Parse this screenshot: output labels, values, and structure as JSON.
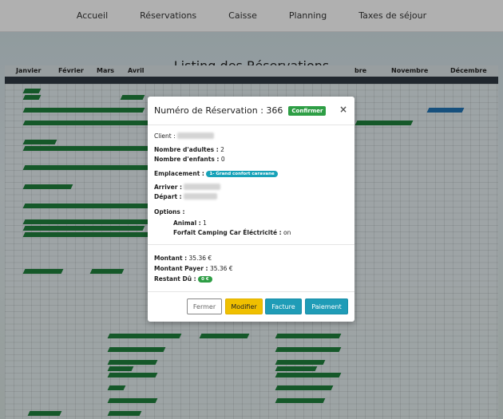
{
  "nav": {
    "items": [
      {
        "label": "Accueil"
      },
      {
        "label": "Réservations"
      },
      {
        "label": "Caisse"
      },
      {
        "label": "Planning"
      },
      {
        "label": "Taxes de séjour"
      }
    ]
  },
  "page": {
    "title": "Listing des Réservations"
  },
  "calendar": {
    "months": [
      "Janvier",
      "Février",
      "Mars",
      "Avril",
      "bre",
      "Novembre",
      "Décembre"
    ]
  },
  "modal": {
    "title": "Numéro de Réservation : 366",
    "status_badge": "Confirmer",
    "close_glyph": "×",
    "client_label": "Client :",
    "adults_label": "Nombre d'adultes :",
    "adults_value": "2",
    "children_label": "Nombre d'enfants :",
    "children_value": "0",
    "location_label": "Emplacement :",
    "location_value": "1- Grand confort caravane",
    "arrival_label": "Arriver :",
    "departure_label": "Départ :",
    "options_label": "Options :",
    "option1_label": "Animal :",
    "option1_value": "1",
    "option2_label": "Forfait Camping Car Éléctricité :",
    "option2_value": "on",
    "amount_label": "Montant :",
    "amount_value": "35.36 €",
    "paid_label": "Montant Payer :",
    "paid_value": "35.36 €",
    "due_label": "Restant Dû :",
    "due_value": "0 €",
    "buttons": {
      "close": "Fermer",
      "edit": "Modifier",
      "invoice": "Facture",
      "payment": "Paiement"
    }
  },
  "colors": {
    "confirm_green": "#2e9e45",
    "accent_teal": "#1f9cb7",
    "warning_yellow": "#f0c000",
    "info_pill": "#17a2b8"
  }
}
